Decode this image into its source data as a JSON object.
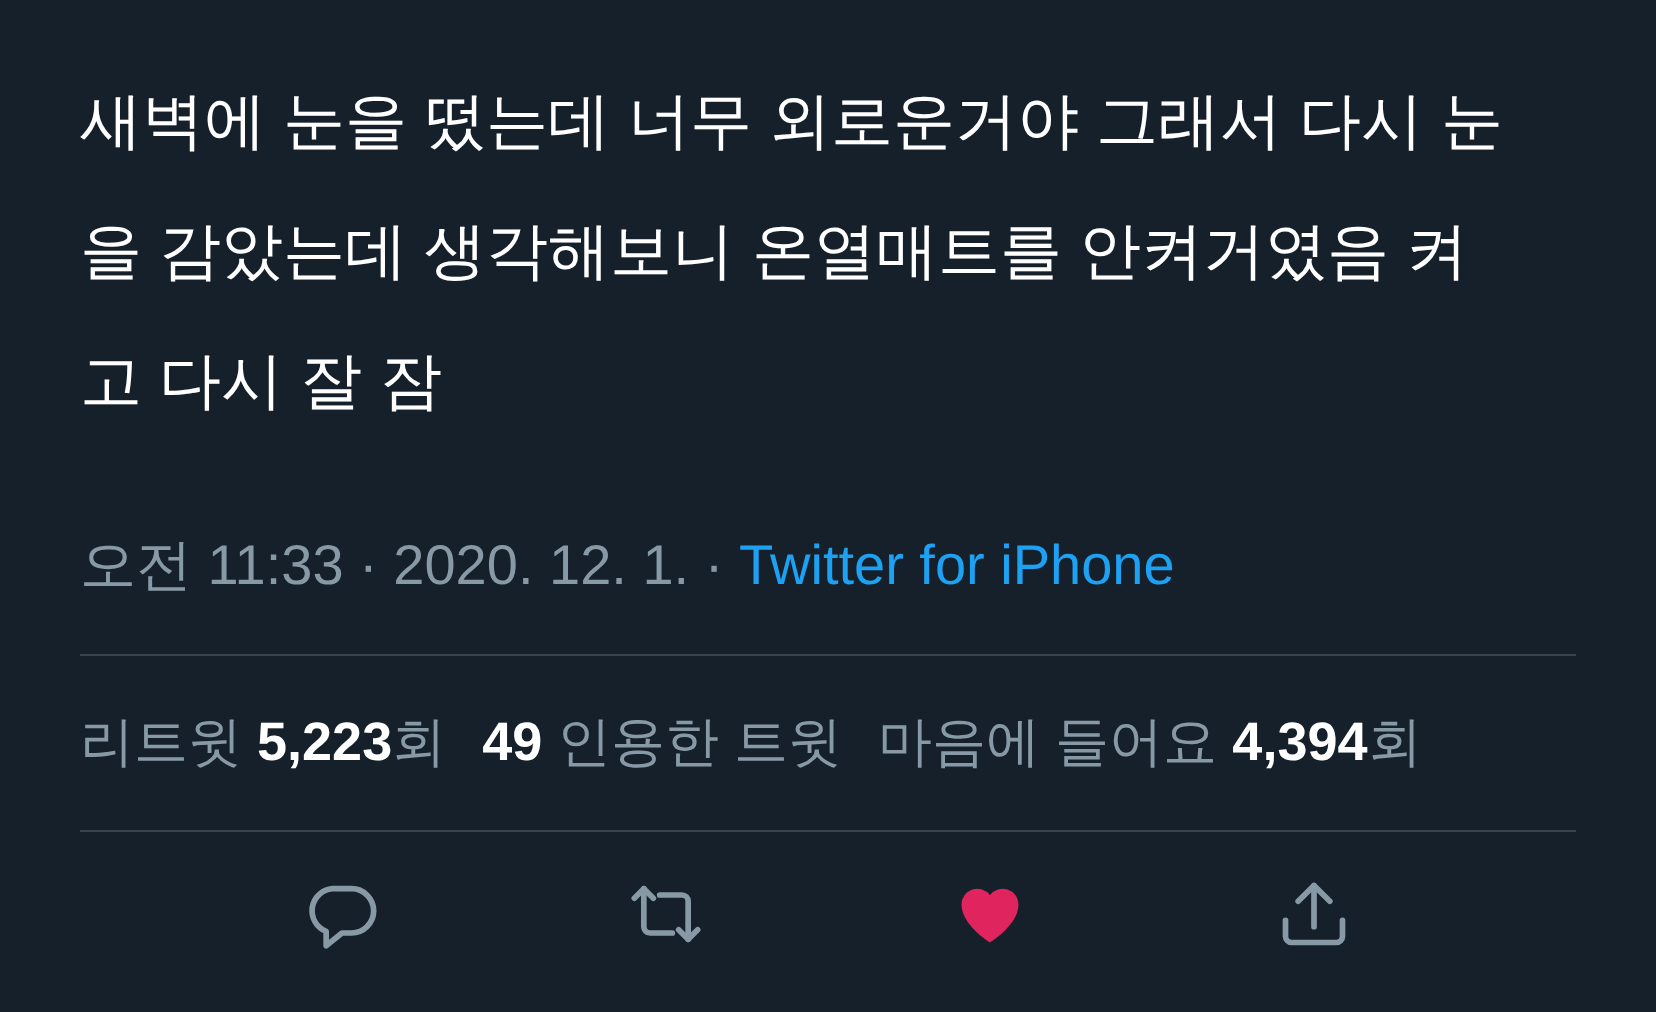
{
  "tweet": {
    "text": "새벽에 눈을 떴는데 너무 외로운거야 그래서 다시 눈을 감았는데 생각해보니 온열매트를 안켜거였음 켜고 다시 잘 잠"
  },
  "meta": {
    "time": "오전 11:33 · 2020. 12. 1. · ",
    "source": "Twitter for iPhone"
  },
  "stats": [
    "리트윗 **5,223**회",
    "**49** 인용한 트윗",
    "마음에 들어요 **4,394**회"
  ],
  "actions": [
    {
      "kind": "reply"
    },
    {
      "kind": "retweet"
    },
    {
      "kind": "like",
      "liked": true
    },
    {
      "kind": "share"
    }
  ]
}
